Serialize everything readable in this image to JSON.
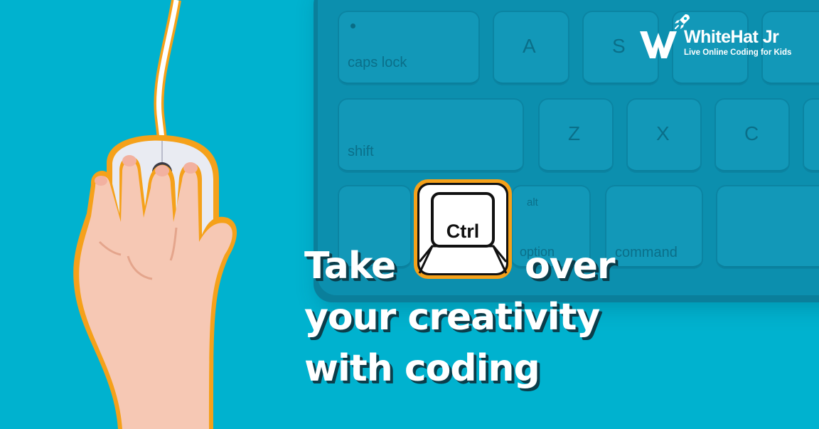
{
  "brand": {
    "name": "WhiteHat Jr",
    "tagline": "Live Online Coding for Kids"
  },
  "keyboard": {
    "keys": {
      "caps_lock": "caps lock",
      "a": "A",
      "s": "S",
      "shift": "shift",
      "z": "Z",
      "x": "X",
      "c": "C",
      "alt": "alt",
      "option": "option",
      "command": "command"
    }
  },
  "ctrl_key": "Ctrl",
  "headline": {
    "take": "Take",
    "over": "over",
    "line2": "your creativity",
    "line3": "with coding"
  },
  "colors": {
    "background": "#00b2cf",
    "keyboard": "#0c8fae",
    "accent_outline": "#f5a11a",
    "text": "#ffffff",
    "text_shadow": "#0b3d4a"
  }
}
